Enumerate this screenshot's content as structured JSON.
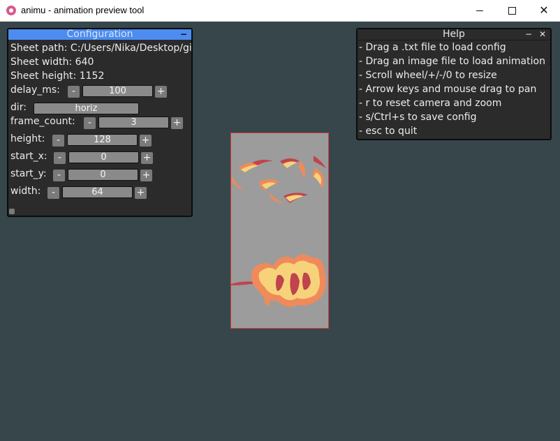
{
  "window": {
    "title": "animu - animation preview tool",
    "icon": "heart-app-icon",
    "minimize_icon": "minimize-icon",
    "maximize_icon": "maximize-icon",
    "close_glyph": "✕"
  },
  "config_panel": {
    "title": "Configuration",
    "collapse_glyph": "−",
    "sheet_path": "Sheet path: C:/Users/Nika/Desktop/gi",
    "sheet_width": "Sheet width: 640",
    "sheet_height": "Sheet height: 1152",
    "fields": {
      "delay_ms": {
        "label": "delay_ms:",
        "value": "100",
        "minus": "-",
        "plus": "+"
      },
      "dir": {
        "label": "dir:",
        "value": "horiz"
      },
      "frame_count": {
        "label": "frame_count:",
        "value": "3",
        "minus": "-",
        "plus": "+"
      },
      "height": {
        "label": "height:",
        "value": "128",
        "minus": "-",
        "plus": "+"
      },
      "start_x": {
        "label": "start_x:",
        "value": "0",
        "minus": "-",
        "plus": "+"
      },
      "start_y": {
        "label": "start_y:",
        "value": "0",
        "minus": "-",
        "plus": "+"
      },
      "width": {
        "label": "width:",
        "value": "64",
        "minus": "-",
        "plus": "+"
      }
    }
  },
  "help_panel": {
    "title": "Help",
    "minimize_glyph": "−",
    "close_glyph": "✕",
    "lines": [
      "- Drag a .txt file to load config",
      "- Drag an image file to load animation",
      "- Scroll wheel/+/-/0 to resize",
      "- Arrow keys and mouse drag to pan",
      "- r to reset camera and zoom",
      "- s/Ctrl+s to save config",
      "- esc to quit"
    ]
  },
  "colors": {
    "background": "#36464a",
    "config_header": "#4d8cf0",
    "panel_bg": "#2b2b2b",
    "sheet_border": "#e03a3a",
    "flame_light": "#f6d37a",
    "flame_mid": "#f08a5a",
    "flame_dark": "#c0434d"
  }
}
